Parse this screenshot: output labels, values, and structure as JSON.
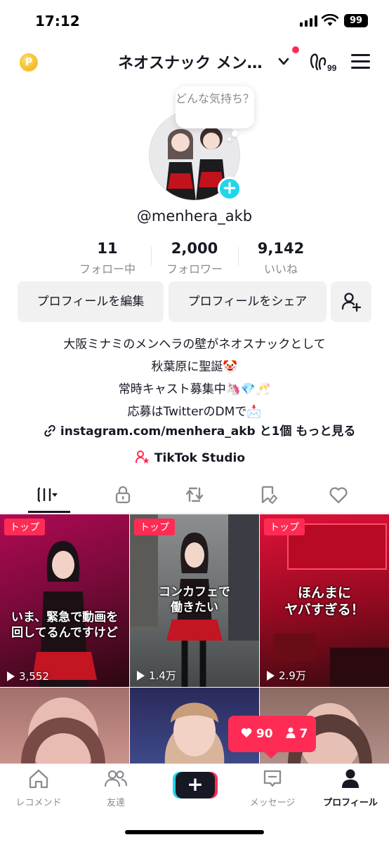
{
  "status_bar": {
    "time": "17:12",
    "battery": "99"
  },
  "header": {
    "account_name": "ネオスナック メン…",
    "coin_glyph": "P"
  },
  "avatar": {
    "mood_prompt": "どんな気持ち？"
  },
  "profile": {
    "username": "@menhera_akb"
  },
  "stats": [
    {
      "value": "11",
      "label": "フォロー中"
    },
    {
      "value": "2,000",
      "label": "フォロワー"
    },
    {
      "value": "9,142",
      "label": "いいね"
    }
  ],
  "actions": {
    "edit_profile": "プロフィールを編集",
    "share_profile": "プロフィールをシェア"
  },
  "bio": {
    "lines": [
      "大阪ミナミのメンヘラの壁がネオスナックとして",
      "秋葉原に聖誕🤡",
      "常時キャスト募集中🦄💎🥂",
      "応募はTwitterのDMで📩"
    ],
    "link_text": "instagram.com/menhera_akb",
    "link_more": "と1個",
    "see_more": "もっと見る",
    "studio": "TikTok Studio"
  },
  "videos": [
    {
      "badge": "トップ",
      "caption": [
        "いま、緊急で動画を",
        "回してるんですけど"
      ],
      "views": "3,552"
    },
    {
      "badge": "トップ",
      "caption": [
        "コンカフェで",
        "働きたい"
      ],
      "views": "1.4万"
    },
    {
      "badge": "トップ",
      "caption": [
        "ほんまに",
        "ヤバすぎる！"
      ],
      "views": "2.9万"
    }
  ],
  "notification": {
    "likes": "90",
    "followers": "7"
  },
  "nav": {
    "items": [
      "レコメンド",
      "友達",
      "メッセージ",
      "プロフィール"
    ],
    "create": "+"
  },
  "colors": {
    "accent": "#fe2c55",
    "cyan": "#20d5ec",
    "text": "#161823",
    "muted": "#8a8b91"
  }
}
